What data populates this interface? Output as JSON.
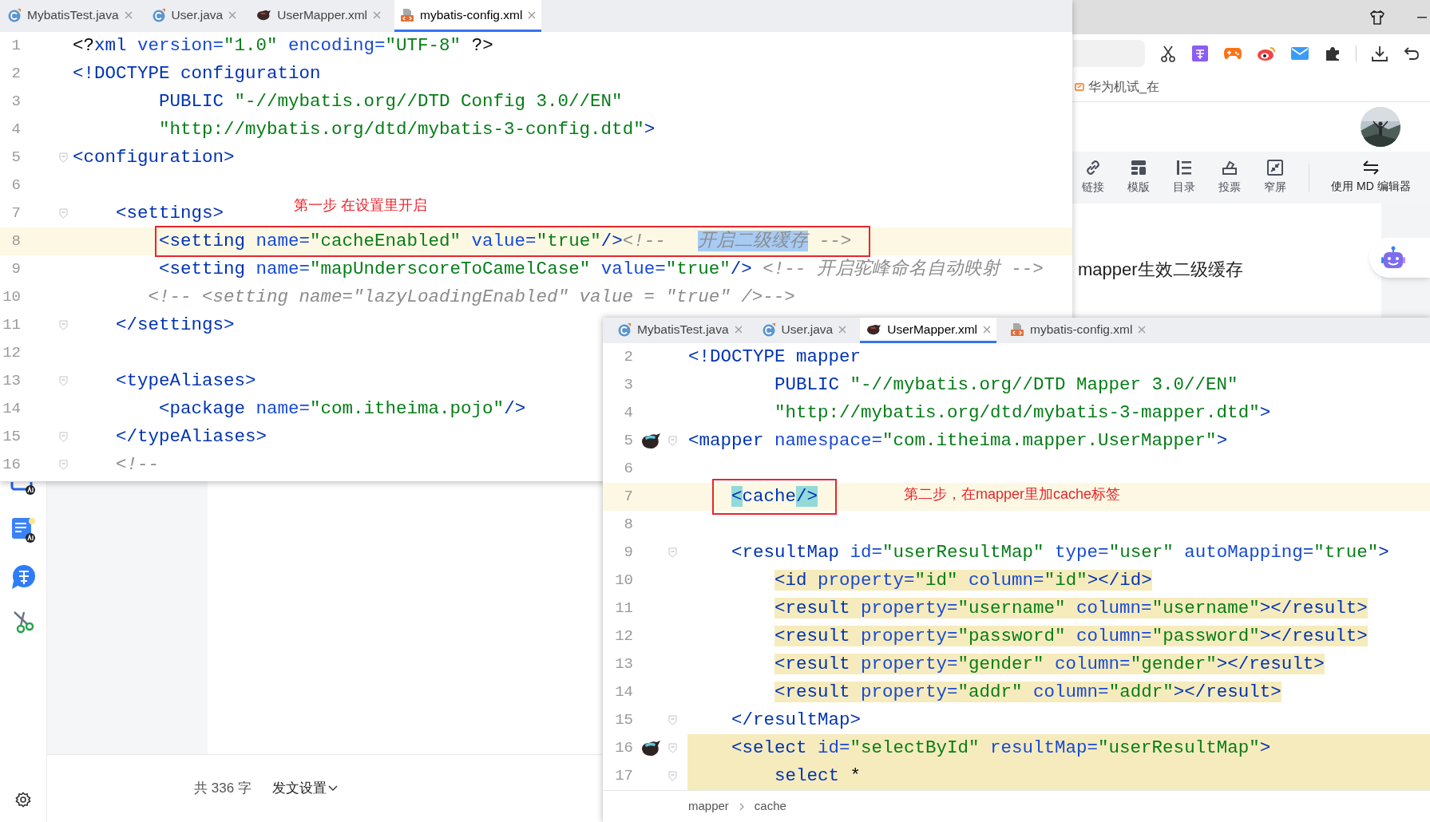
{
  "browser": {
    "bookmark": "华为机试_在",
    "editor_toolbar": [
      {
        "label": "链接",
        "kind": "link"
      },
      {
        "label": "模版",
        "kind": "template"
      },
      {
        "label": "目录",
        "kind": "outline"
      },
      {
        "label": "投票",
        "kind": "vote"
      },
      {
        "label": "窄屏",
        "kind": "narrow"
      },
      {
        "label": "使用 MD 编辑器",
        "kind": "switch"
      }
    ],
    "article_title": "mapper生效二级缓存",
    "word_count": "共 336 字",
    "publish_settings": "发文设置"
  },
  "config_editor": {
    "tabs": [
      {
        "label": "MybatisTest.java",
        "kind": "class",
        "selected": false
      },
      {
        "label": "User.java",
        "kind": "class",
        "selected": false
      },
      {
        "label": "UserMapper.xml",
        "kind": "mapper",
        "selected": false
      },
      {
        "label": "mybatis-config.xml",
        "kind": "xml",
        "selected": true
      }
    ],
    "annotation": "第一步 在设置里开启",
    "lines": [
      {
        "number": "1",
        "fold": false,
        "current": false,
        "framed": false,
        "tokens": [
          {
            "kind": "punct",
            "text": "<?"
          },
          {
            "kind": "tag",
            "text": "xml"
          },
          {
            "kind": "attr",
            "text": " version="
          },
          {
            "kind": "value",
            "text": "\"1.0\""
          },
          {
            "kind": "attr",
            "text": " encoding="
          },
          {
            "kind": "value",
            "text": "\"UTF-8\""
          },
          {
            "kind": "punct",
            "text": " ?>"
          }
        ]
      },
      {
        "number": "2",
        "fold": false,
        "current": false,
        "framed": false,
        "tokens": [
          {
            "kind": "tag",
            "text": "<!DOCTYPE configuration"
          }
        ]
      },
      {
        "number": "3",
        "fold": false,
        "current": false,
        "framed": false,
        "tokens": [
          {
            "kind": "tag",
            "text": "        PUBLIC "
          },
          {
            "kind": "value",
            "text": "\"-//mybatis.org//DTD Config 3.0//EN\""
          }
        ]
      },
      {
        "number": "4",
        "fold": false,
        "current": false,
        "framed": false,
        "tokens": [
          {
            "kind": "value",
            "text": "        \"http://mybatis.org/dtd/mybatis-3-config.dtd\""
          },
          {
            "kind": "tag",
            "text": ">"
          }
        ]
      },
      {
        "number": "5",
        "fold": true,
        "current": false,
        "framed": false,
        "tokens": [
          {
            "kind": "tag",
            "text": "<configuration>"
          }
        ]
      },
      {
        "number": "6",
        "fold": false,
        "current": false
      },
      {
        "number": "7",
        "fold": true,
        "current": false,
        "framed": false,
        "tokens": [
          {
            "kind": "tag",
            "text": "    <settings>"
          }
        ]
      },
      {
        "number": "8",
        "fold": false,
        "current": true,
        "framed": true,
        "tokens": [
          {
            "kind": "tag",
            "text": "        <setting"
          },
          {
            "kind": "attr",
            "text": " name="
          },
          {
            "kind": "value",
            "text": "\"cacheEnabled\""
          },
          {
            "kind": "attr",
            "text": " value="
          },
          {
            "kind": "value",
            "text": "\"true\""
          },
          {
            "kind": "tag",
            "text": "/>"
          },
          {
            "kind": "comment",
            "text": "<!--   "
          },
          {
            "kind": "selection",
            "text": "开启二级缓存"
          },
          {
            "kind": "comment",
            "text": " -->"
          }
        ]
      },
      {
        "number": "9",
        "fold": false,
        "current": false,
        "framed": false,
        "tokens": [
          {
            "kind": "tag",
            "text": "        <setting"
          },
          {
            "kind": "attr",
            "text": " name="
          },
          {
            "kind": "value",
            "text": "\"mapUnderscoreToCamelCase\""
          },
          {
            "kind": "attr",
            "text": " value="
          },
          {
            "kind": "value",
            "text": "\"true\""
          },
          {
            "kind": "tag",
            "text": "/>"
          },
          {
            "kind": "comment",
            "text": " <!-- 开启驼峰命名自动映射 -->"
          }
        ]
      },
      {
        "number": "10",
        "fold": false,
        "current": false,
        "framed": false,
        "tokens": [
          {
            "kind": "comment",
            "text": "       <!-- <setting name=\"lazyLoadingEnabled\" value = \"true\" />-->"
          }
        ]
      },
      {
        "number": "11",
        "fold": true,
        "current": false,
        "framed": false,
        "tokens": [
          {
            "kind": "tag",
            "text": "    </settings>"
          }
        ]
      },
      {
        "number": "12",
        "fold": false,
        "current": false
      },
      {
        "number": "13",
        "fold": true,
        "current": false,
        "framed": false,
        "tokens": [
          {
            "kind": "tag",
            "text": "    <typeAliases>"
          }
        ]
      },
      {
        "number": "14",
        "fold": false,
        "current": false,
        "framed": false,
        "tokens": [
          {
            "kind": "tag",
            "text": "        <package"
          },
          {
            "kind": "attr",
            "text": " name="
          },
          {
            "kind": "value",
            "text": "\"com.itheima.pojo\""
          },
          {
            "kind": "tag",
            "text": "/>"
          }
        ]
      },
      {
        "number": "15",
        "fold": true,
        "current": false,
        "framed": false,
        "tokens": [
          {
            "kind": "tag",
            "text": "    </typeAliases>"
          }
        ]
      },
      {
        "number": "16",
        "fold": true,
        "current": false,
        "framed": false,
        "tokens": [
          {
            "kind": "comment",
            "text": "    <!--"
          }
        ]
      }
    ]
  },
  "mapper_editor": {
    "tabs": [
      {
        "label": "MybatisTest.java",
        "kind": "class",
        "selected": false
      },
      {
        "label": "User.java",
        "kind": "class",
        "selected": false
      },
      {
        "label": "UserMapper.xml",
        "kind": "mapper",
        "selected": true
      },
      {
        "label": "mybatis-config.xml",
        "kind": "xml",
        "selected": false
      }
    ],
    "annotation": "第二步，在mapper里加cache标签",
    "lines": [
      {
        "number": "2",
        "fold": false,
        "marker": false,
        "current": false,
        "framed": false,
        "text_highlight": false,
        "row_highlight": false,
        "tokens": [
          {
            "kind": "tag",
            "text": "<!DOCTYPE mapper"
          }
        ]
      },
      {
        "number": "3",
        "fold": false,
        "marker": false,
        "current": false,
        "framed": false,
        "text_highlight": false,
        "row_highlight": false,
        "tokens": [
          {
            "kind": "tag",
            "text": "        PUBLIC "
          },
          {
            "kind": "value",
            "text": "\"-//mybatis.org//DTD Mapper 3.0//EN\""
          }
        ]
      },
      {
        "number": "4",
        "fold": false,
        "marker": false,
        "current": false,
        "framed": false,
        "text_highlight": false,
        "row_highlight": false,
        "tokens": [
          {
            "kind": "value",
            "text": "        \"http://mybatis.org/dtd/mybatis-3-mapper.dtd\""
          },
          {
            "kind": "tag",
            "text": ">"
          }
        ]
      },
      {
        "number": "5",
        "fold": true,
        "marker": true,
        "current": false,
        "framed": false,
        "text_highlight": false,
        "row_highlight": false,
        "tokens": [
          {
            "kind": "tag",
            "text": "<mapper"
          },
          {
            "kind": "attr",
            "text": " namespace="
          },
          {
            "kind": "value",
            "text": "\"com.itheima.mapper.UserMapper\""
          },
          {
            "kind": "tag",
            "text": ">"
          }
        ]
      },
      {
        "number": "6",
        "fold": false,
        "marker": false,
        "current": false,
        "row_highlight": false
      },
      {
        "number": "7",
        "fold": false,
        "marker": false,
        "current": true,
        "framed": true,
        "text_highlight": false,
        "row_highlight": false,
        "tokens": [
          {
            "kind": "match",
            "text": "    <"
          },
          {
            "kind": "tag",
            "text": "cache"
          },
          {
            "kind": "match",
            "text": "/>"
          }
        ]
      },
      {
        "number": "8",
        "fold": false,
        "marker": false,
        "current": false,
        "row_highlight": false
      },
      {
        "number": "9",
        "fold": true,
        "marker": false,
        "current": false,
        "framed": false,
        "text_highlight": false,
        "row_highlight": false,
        "tokens": [
          {
            "kind": "tag",
            "text": "    <resultMap"
          },
          {
            "kind": "attr",
            "text": " id="
          },
          {
            "kind": "value",
            "text": "\"userResultMap\""
          },
          {
            "kind": "attr",
            "text": " type="
          },
          {
            "kind": "value",
            "text": "\"user\""
          },
          {
            "kind": "attr",
            "text": " autoMapping="
          },
          {
            "kind": "value",
            "text": "\"true\""
          },
          {
            "kind": "tag",
            "text": ">"
          }
        ]
      },
      {
        "number": "10",
        "fold": false,
        "marker": false,
        "current": false,
        "framed": false,
        "text_highlight": true,
        "row_highlight": false,
        "tokens": [
          {
            "kind": "tag",
            "text": "        <id"
          },
          {
            "kind": "attr",
            "text": " property="
          },
          {
            "kind": "value",
            "text": "\"id\""
          },
          {
            "kind": "attr",
            "text": " column="
          },
          {
            "kind": "value",
            "text": "\"id\""
          },
          {
            "kind": "tag",
            "text": "></id>"
          }
        ]
      },
      {
        "number": "11",
        "fold": false,
        "marker": false,
        "current": false,
        "framed": false,
        "text_highlight": true,
        "row_highlight": false,
        "tokens": [
          {
            "kind": "tag",
            "text": "        <result"
          },
          {
            "kind": "attr",
            "text": " property="
          },
          {
            "kind": "value",
            "text": "\"username\""
          },
          {
            "kind": "attr",
            "text": " column="
          },
          {
            "kind": "value",
            "text": "\"username\""
          },
          {
            "kind": "tag",
            "text": "></result>"
          }
        ]
      },
      {
        "number": "12",
        "fold": false,
        "marker": false,
        "current": false,
        "framed": false,
        "text_highlight": true,
        "row_highlight": false,
        "tokens": [
          {
            "kind": "tag",
            "text": "        <result"
          },
          {
            "kind": "attr",
            "text": " property="
          },
          {
            "kind": "value",
            "text": "\"password\""
          },
          {
            "kind": "attr",
            "text": " column="
          },
          {
            "kind": "value",
            "text": "\"password\""
          },
          {
            "kind": "tag",
            "text": "></result>"
          }
        ]
      },
      {
        "number": "13",
        "fold": false,
        "marker": false,
        "current": false,
        "framed": false,
        "text_highlight": true,
        "row_highlight": false,
        "tokens": [
          {
            "kind": "tag",
            "text": "        <result"
          },
          {
            "kind": "attr",
            "text": " property="
          },
          {
            "kind": "value",
            "text": "\"gender\""
          },
          {
            "kind": "attr",
            "text": " column="
          },
          {
            "kind": "value",
            "text": "\"gender\""
          },
          {
            "kind": "tag",
            "text": "></result>"
          }
        ]
      },
      {
        "number": "14",
        "fold": false,
        "marker": false,
        "current": false,
        "framed": false,
        "text_highlight": true,
        "row_highlight": false,
        "tokens": [
          {
            "kind": "tag",
            "text": "        <result"
          },
          {
            "kind": "attr",
            "text": " property="
          },
          {
            "kind": "value",
            "text": "\"addr\""
          },
          {
            "kind": "attr",
            "text": " column="
          },
          {
            "kind": "value",
            "text": "\"addr\""
          },
          {
            "kind": "tag",
            "text": "></result>"
          }
        ]
      },
      {
        "number": "15",
        "fold": true,
        "marker": false,
        "current": false,
        "framed": false,
        "text_highlight": false,
        "row_highlight": false,
        "tokens": [
          {
            "kind": "tag",
            "text": "    </resultMap>"
          }
        ]
      },
      {
        "number": "16",
        "fold": true,
        "marker": true,
        "current": false,
        "framed": false,
        "text_highlight": false,
        "row_highlight": true,
        "tokens": [
          {
            "kind": "tag",
            "text": "    <select"
          },
          {
            "kind": "attr",
            "text": " id="
          },
          {
            "kind": "value",
            "text": "\"selectById\""
          },
          {
            "kind": "attr",
            "text": " resultMap="
          },
          {
            "kind": "value",
            "text": "\"userResultMap\""
          },
          {
            "kind": "tag",
            "text": ">"
          }
        ]
      },
      {
        "number": "17",
        "fold": true,
        "marker": false,
        "current": false,
        "framed": false,
        "text_highlight": false,
        "row_highlight": true,
        "tokens": [
          {
            "kind": "keyword",
            "text": "        select"
          },
          {
            "kind": "punct",
            "text": " *"
          }
        ]
      }
    ],
    "breadcrumb": [
      "mapper",
      "cache"
    ]
  }
}
